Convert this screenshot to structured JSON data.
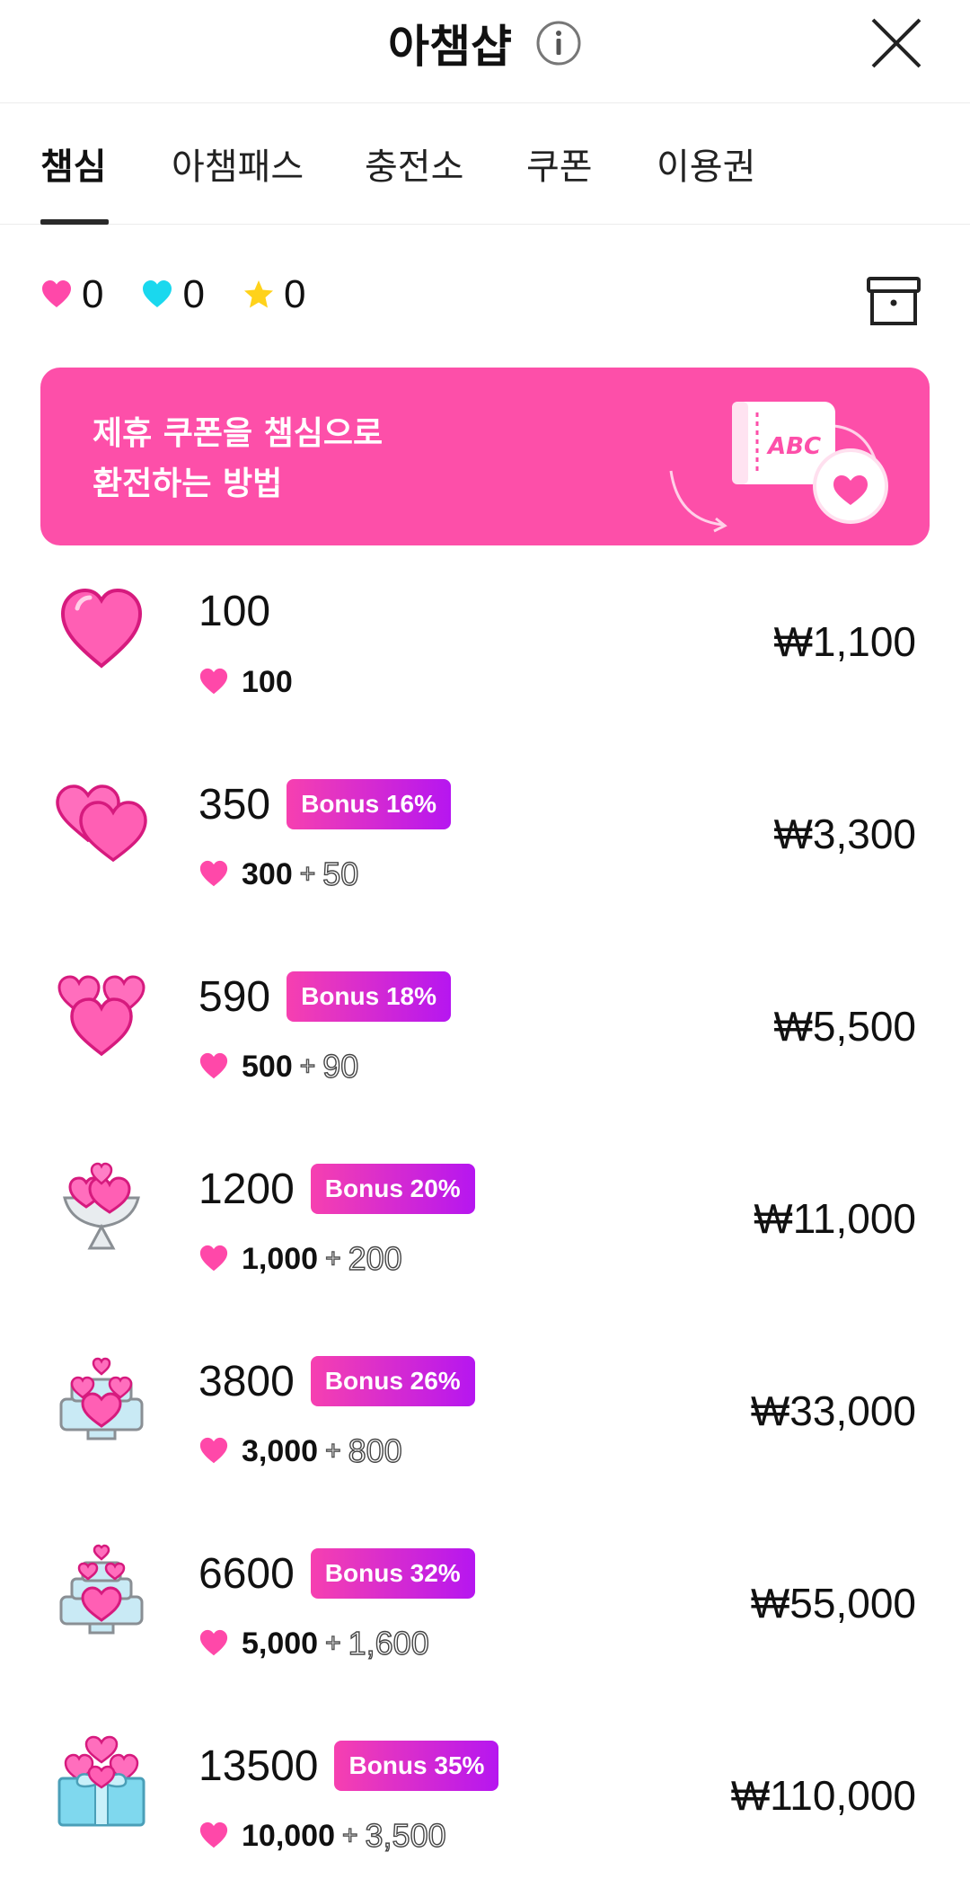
{
  "header": {
    "title": "아챔샵"
  },
  "tabs": [
    {
      "label": "챔심",
      "active": true
    },
    {
      "label": "아챔패스",
      "active": false
    },
    {
      "label": "충전소",
      "active": false
    },
    {
      "label": "쿠폰",
      "active": false
    },
    {
      "label": "이용권",
      "active": false
    }
  ],
  "balances": {
    "pink_heart": {
      "icon": "pink-heart-icon",
      "value": "0",
      "color": "#ff48a9"
    },
    "cyan_heart": {
      "icon": "cyan-heart-icon",
      "value": "0",
      "color": "#1ad8ee"
    },
    "star": {
      "icon": "star-icon",
      "value": "0",
      "color": "#ffd21a"
    }
  },
  "banner": {
    "line1": "제휴 쿠폰을 챔심으로",
    "line2": "환전하는 방법",
    "art_label": "ABC",
    "background": "#fd4fa9"
  },
  "items": [
    {
      "amount": "100",
      "badge": "",
      "base": "100",
      "plus": "",
      "bonus": "",
      "price": "₩1,100",
      "icon": "single-heart-icon"
    },
    {
      "amount": "350",
      "badge": "Bonus 16%",
      "base": "300",
      "plus": "+",
      "bonus": "50",
      "price": "₩3,300",
      "icon": "double-hearts-icon"
    },
    {
      "amount": "590",
      "badge": "Bonus 18%",
      "base": "500",
      "plus": "+",
      "bonus": "90",
      "price": "₩5,500",
      "icon": "triple-hearts-icon"
    },
    {
      "amount": "1200",
      "badge": "Bonus 20%",
      "base": "1,000",
      "plus": "+",
      "bonus": "200",
      "price": "₩11,000",
      "icon": "heart-bouquet-icon"
    },
    {
      "amount": "3800",
      "badge": "Bonus 26%",
      "base": "3,000",
      "plus": "+",
      "bonus": "800",
      "price": "₩33,000",
      "icon": "heart-cake-icon"
    },
    {
      "amount": "6600",
      "badge": "Bonus 32%",
      "base": "5,000",
      "plus": "+",
      "bonus": "1,600",
      "price": "₩55,000",
      "icon": "heart-tiered-cake-icon"
    },
    {
      "amount": "13500",
      "badge": "Bonus 35%",
      "base": "10,000",
      "plus": "+",
      "bonus": "3,500",
      "price": "₩110,000",
      "icon": "heart-gift-box-icon"
    }
  ],
  "colors": {
    "accent_pink": "#ff48a9",
    "badge_start": "#f640b0",
    "badge_end": "#b616f0"
  }
}
